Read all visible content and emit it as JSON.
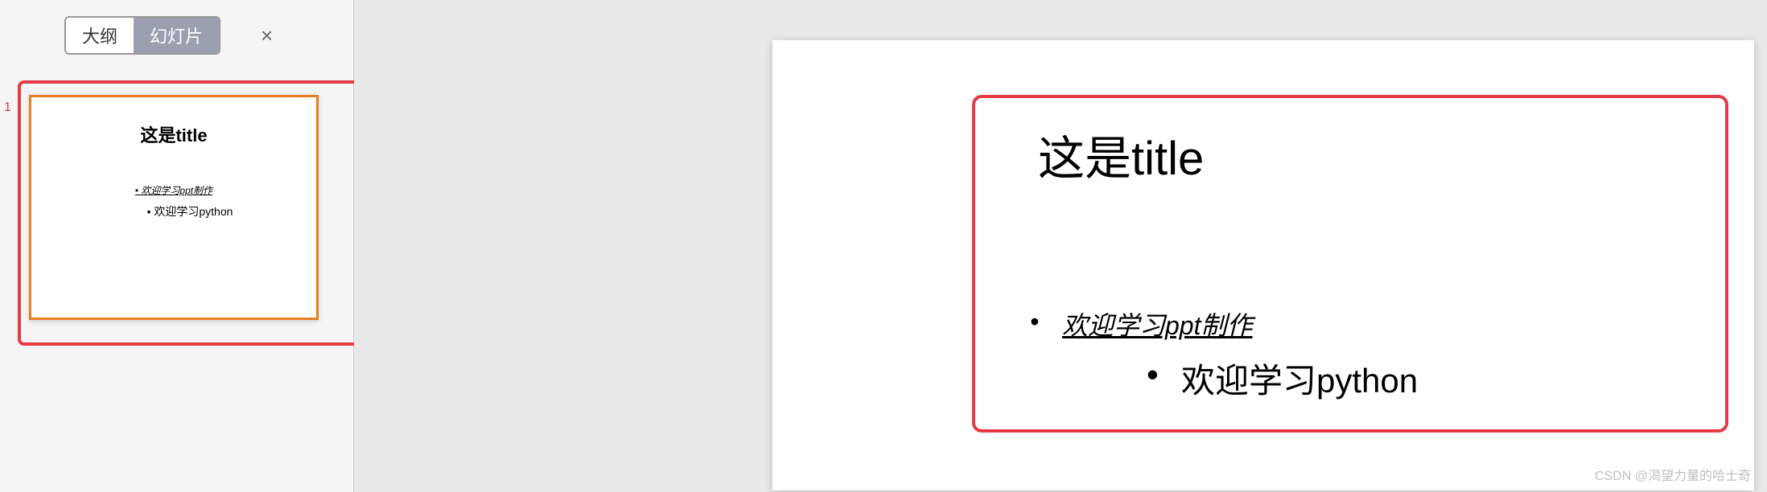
{
  "sidebar": {
    "tabs": {
      "outline": "大纲",
      "slides": "幻灯片"
    },
    "close": "×",
    "slide_number": "1"
  },
  "thumbnail": {
    "title": "这是title",
    "bullet1": "欢迎学习ppt制作",
    "bullet2": "欢迎学习python"
  },
  "slide": {
    "title": "这是title",
    "bullet1": "欢迎学习ppt制作",
    "bullet2": "欢迎学习python",
    "dot1": "•",
    "dot2": "•"
  },
  "watermark": "CSDN @渴望力量的哈士奇"
}
